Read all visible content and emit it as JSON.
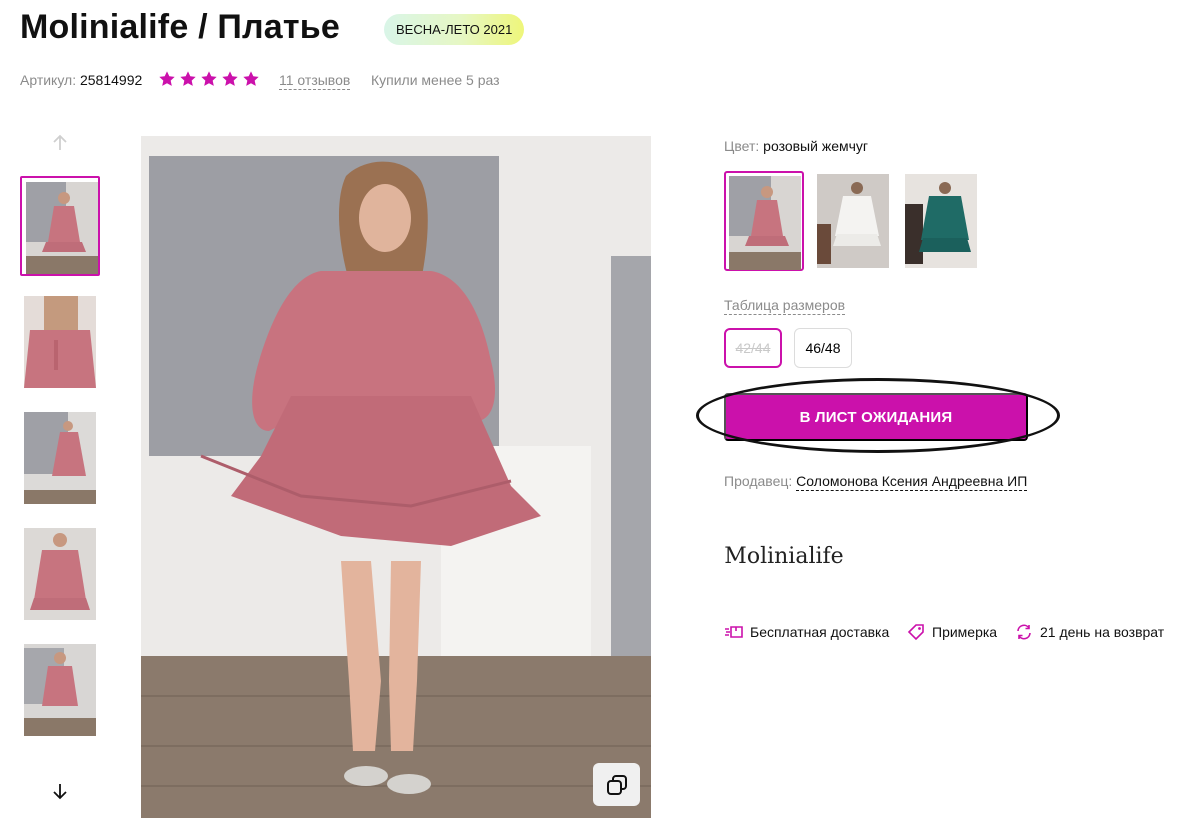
{
  "product": {
    "title": "Molinialife / Платье",
    "season_badge": "ВЕСНА-ЛЕТО 2021",
    "article_label": "Артикул:",
    "article_value": "25814992",
    "rating": 5,
    "reviews": "11 отзывов",
    "bought": "Купили менее 5 раз"
  },
  "gallery": {
    "thumbnails": [
      "thumb-1",
      "thumb-2",
      "thumb-3",
      "thumb-4",
      "thumb-5"
    ],
    "active_index": 0
  },
  "options": {
    "color_label": "Цвет:",
    "color_value": "розовый жемчуг",
    "colors": [
      "pink",
      "white",
      "teal"
    ],
    "size_table_link": "Таблица размеров",
    "sizes": [
      "42/44",
      "46/48"
    ]
  },
  "actions": {
    "waitlist_button": "В ЛИСТ ОЖИДАНИЯ"
  },
  "seller": {
    "label": "Продавец:",
    "name": "Соломонова Ксения Андреевна ИП"
  },
  "brand": {
    "logo_text": "Molinialife"
  },
  "features": [
    {
      "icon": "delivery-icon",
      "text": "Бесплатная доставка"
    },
    {
      "icon": "tag-icon",
      "text": "Примерка"
    },
    {
      "icon": "return-icon",
      "text": "21 день на возврат"
    }
  ],
  "colors": {
    "accent": "#cb11ab",
    "star": "#cb11ab"
  }
}
